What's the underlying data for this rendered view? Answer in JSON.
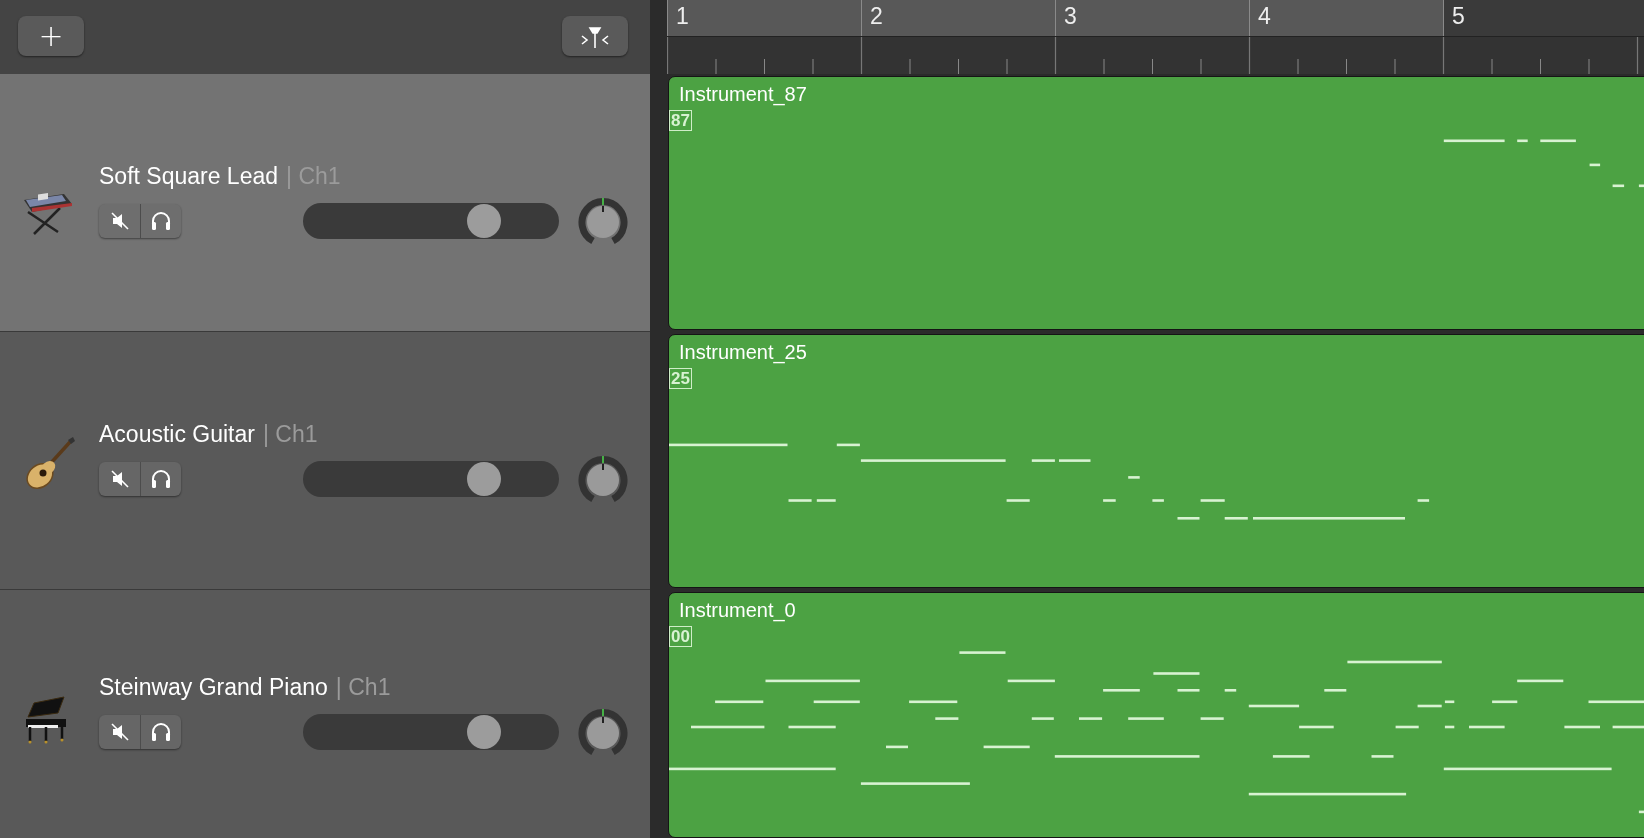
{
  "toolbar": {
    "add_button": {
      "label": "+"
    }
  },
  "ruler": {
    "bars": [
      {
        "label": "1",
        "in_cycle": true
      },
      {
        "label": "2",
        "in_cycle": true
      },
      {
        "label": "3",
        "in_cycle": true
      },
      {
        "label": "4",
        "in_cycle": true
      },
      {
        "label": "5",
        "in_cycle": false
      }
    ]
  },
  "tracks": [
    {
      "name": "Soft Square Lead",
      "channel": "| Ch1",
      "kind": "synth",
      "selected": true,
      "muted": false,
      "solo": false,
      "volume": {
        "level": 0.74
      },
      "region": {
        "name": "Instrument_87",
        "badge": "87"
      }
    },
    {
      "name": "Acoustic Guitar",
      "channel": "| Ch1",
      "kind": "guitar",
      "selected": false,
      "muted": false,
      "solo": false,
      "volume": {
        "level": 0.74
      },
      "region": {
        "name": "Instrument_25",
        "badge": "25"
      }
    },
    {
      "name": "Steinway Grand Piano",
      "channel": "| Ch1",
      "kind": "piano",
      "selected": false,
      "muted": false,
      "solo": false,
      "volume": {
        "level": 0.74
      },
      "region": {
        "name": "Instrument_0",
        "badge": "00"
      }
    }
  ]
}
